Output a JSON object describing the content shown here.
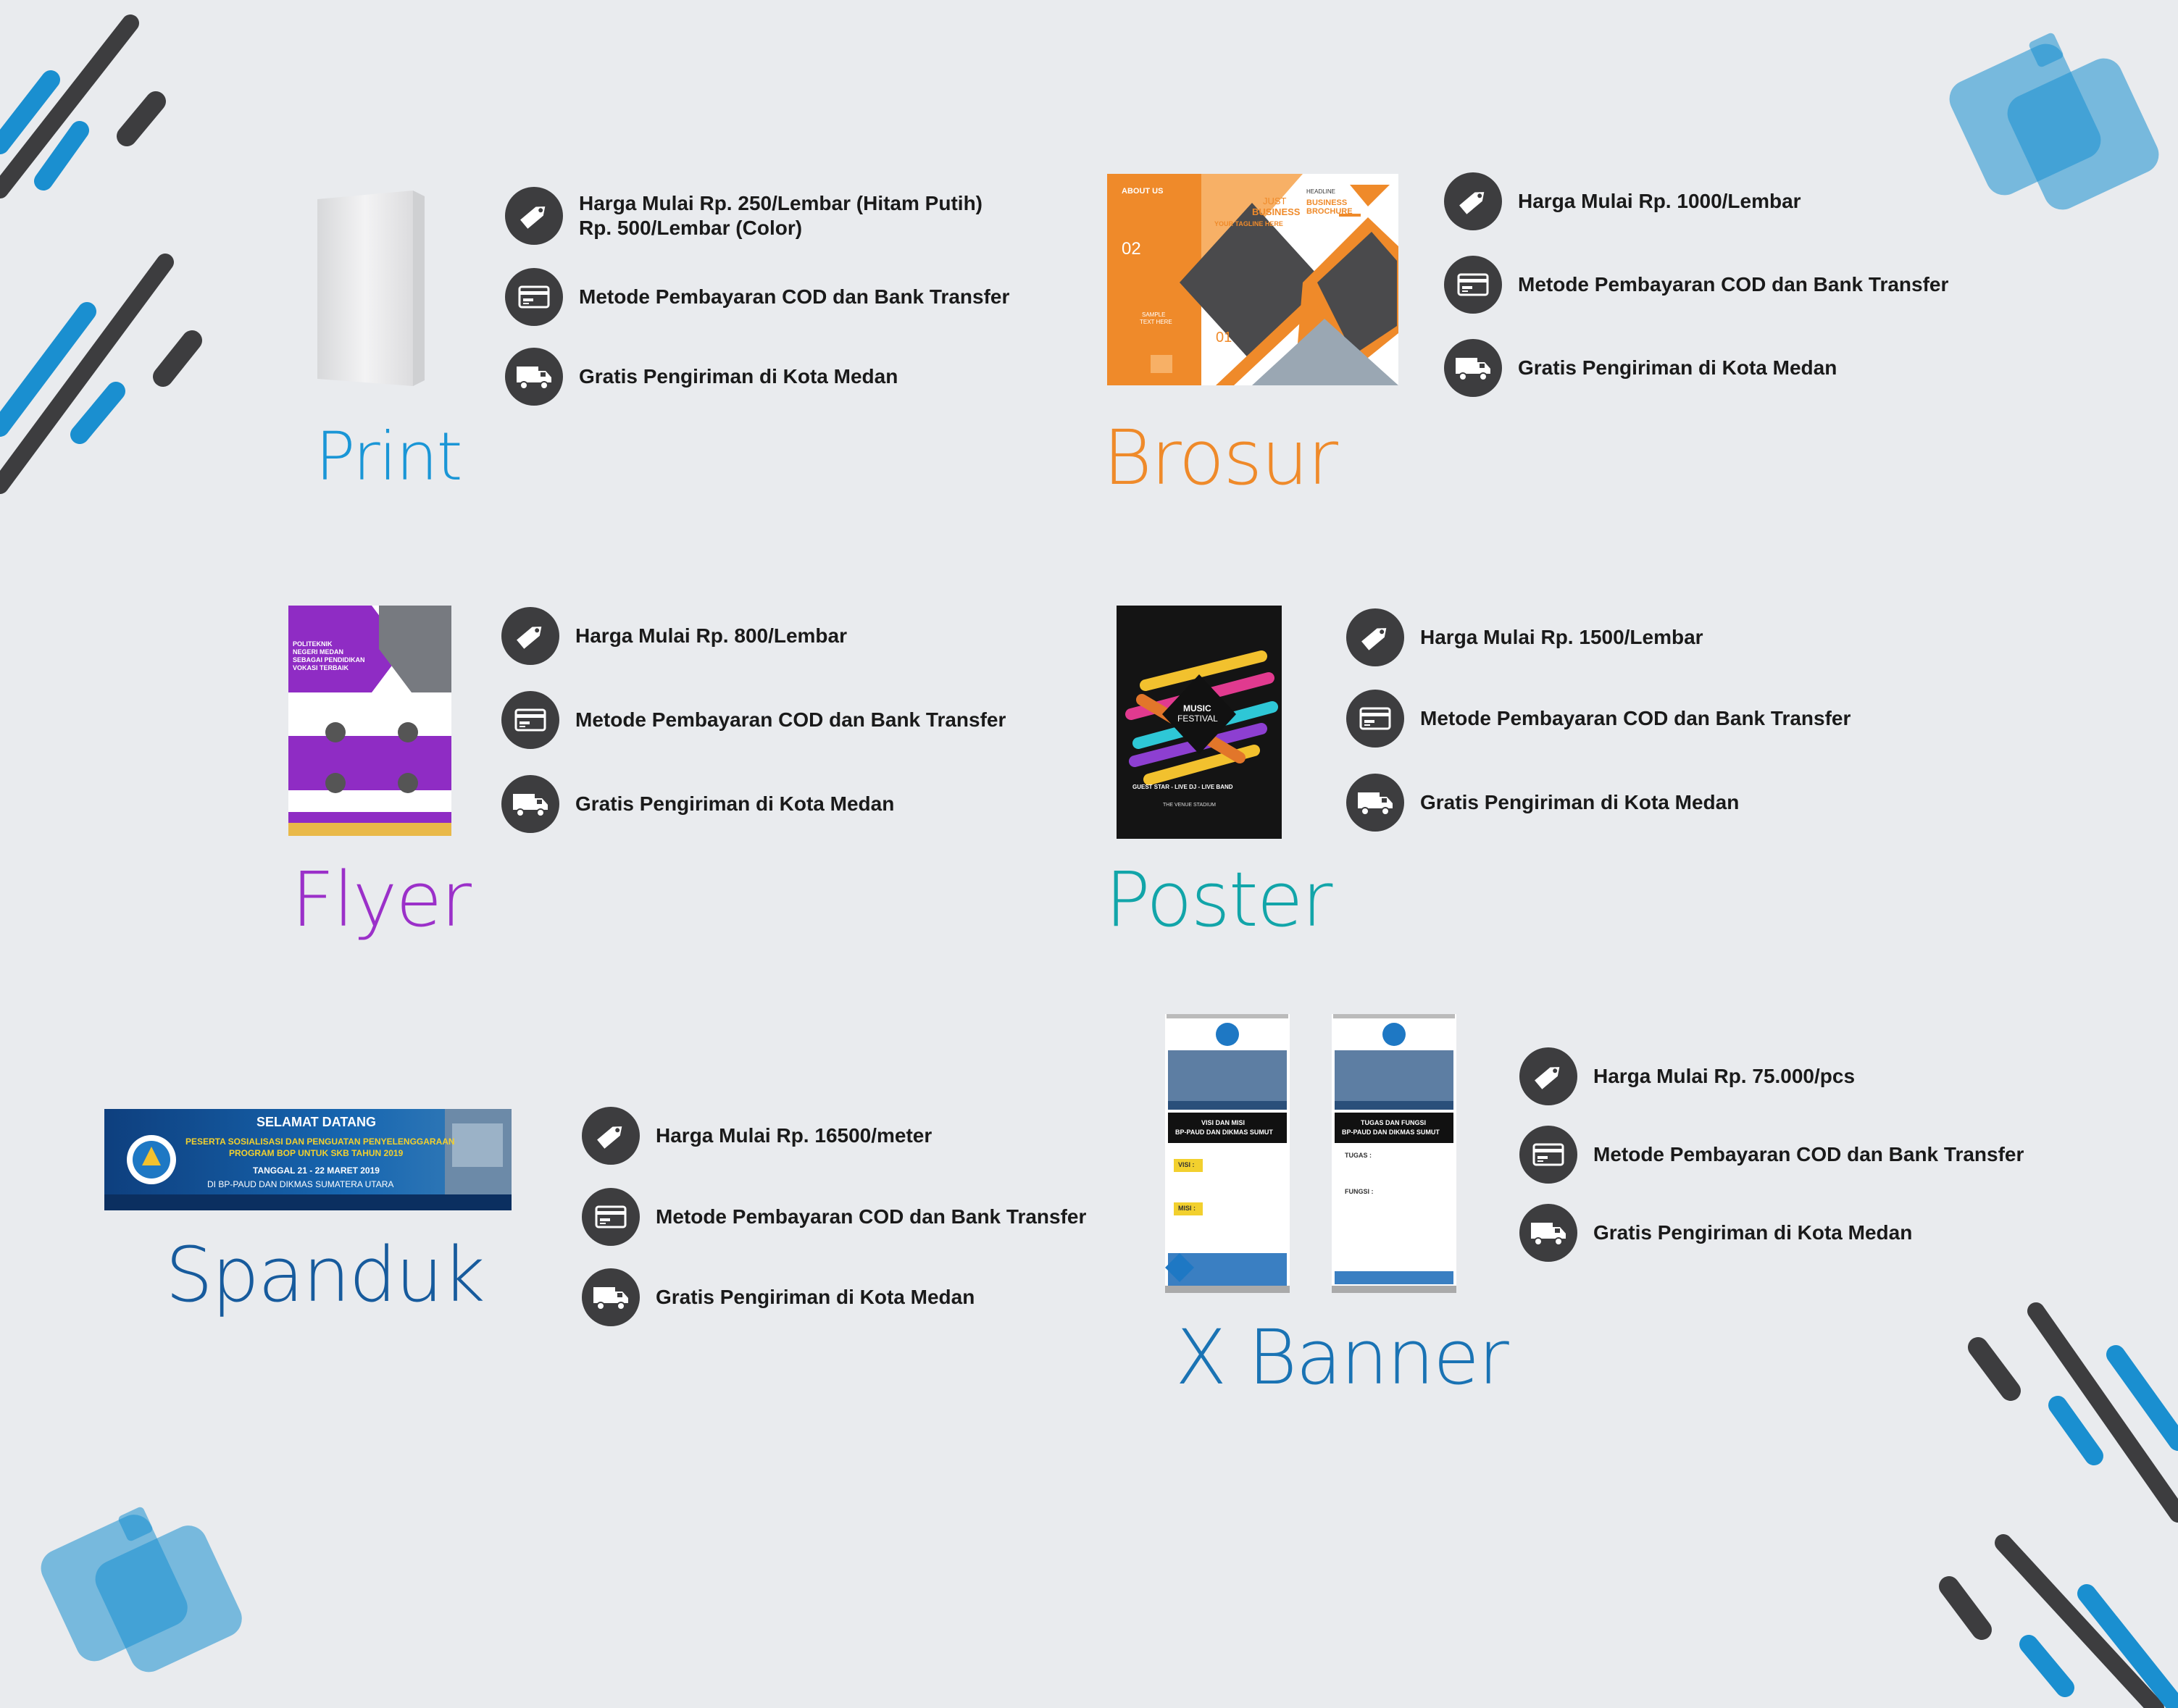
{
  "colors": {
    "background": "#e9ebee",
    "print": "#1a96d6",
    "brosur": "#ef8a2a",
    "flyer": "#9b30c9",
    "poster": "#12a5a9",
    "spanduk": "#175b9d",
    "xbanner": "#1a73b4",
    "icon_bg": "#3d3d3f"
  },
  "icons": [
    "price-tag-icon",
    "payment-card-icon",
    "delivery-truck-icon"
  ],
  "products": {
    "print": {
      "title": "Print",
      "features": [
        {
          "lines": [
            "Harga Mulai Rp. 250/Lembar (Hitam Putih)",
            "Rp. 500/Lembar (Color)"
          ]
        },
        {
          "lines": [
            "Metode Pembayaran COD dan Bank Transfer"
          ]
        },
        {
          "lines": [
            "Gratis Pengiriman di Kota Medan"
          ]
        }
      ]
    },
    "brosur": {
      "title": "Brosur",
      "features": [
        {
          "lines": [
            "Harga Mulai Rp. 1000/Lembar"
          ]
        },
        {
          "lines": [
            "Metode Pembayaran COD dan Bank Transfer"
          ]
        },
        {
          "lines": [
            "Gratis Pengiriman di Kota Medan"
          ]
        }
      ],
      "preview": {
        "about": "ABOUT US",
        "just": "JUST",
        "business": "BUSINESS",
        "tagline": "YOUR TAGLINE HERE",
        "headline": "HEADLINE",
        "brochure_a": "BUSINESS",
        "brochure_b": "BROCHURE",
        "num_a": "02",
        "num_b": "01",
        "sample": "SAMPLE",
        "text_here": "TEXT HERE"
      }
    },
    "flyer": {
      "title": "Flyer",
      "features": [
        {
          "lines": [
            "Harga Mulai Rp. 800/Lembar"
          ]
        },
        {
          "lines": [
            "Metode Pembayaran COD dan Bank Transfer"
          ]
        },
        {
          "lines": [
            "Gratis Pengiriman di Kota Medan"
          ]
        }
      ],
      "preview": {
        "l1": "POLITEKNIK",
        "l2": "NEGERI MEDAN",
        "l3": "SEBAGAI PENDIDIKAN",
        "l4": "VOKASI TERBAIK"
      }
    },
    "poster": {
      "title": "Poster",
      "features": [
        {
          "lines": [
            "Harga Mulai Rp. 1500/Lembar"
          ]
        },
        {
          "lines": [
            "Metode Pembayaran COD dan Bank Transfer"
          ]
        },
        {
          "lines": [
            "Gratis Pengiriman di Kota Medan"
          ]
        }
      ],
      "preview": {
        "music": "MUSIC",
        "festival": "FESTIVAL",
        "guest": "GUEST STAR - LIVE DJ - LIVE BAND",
        "venue": "THE VENUE STADIUM"
      }
    },
    "spanduk": {
      "title": "Spanduk",
      "features": [
        {
          "lines": [
            "Harga Mulai Rp. 16500/meter"
          ]
        },
        {
          "lines": [
            "Metode Pembayaran COD dan Bank Transfer"
          ]
        },
        {
          "lines": [
            "Gratis Pengiriman di Kota Medan"
          ]
        }
      ],
      "preview": {
        "welcome": "SELAMAT DATANG",
        "line1": "PESERTA SOSIALISASI DAN PENGUATAN PENYELENGGARAAN",
        "line2": "PROGRAM BOP UNTUK SKB TAHUN 2019",
        "date": "TANGGAL 21 - 22 MARET 2019",
        "place": "DI BP-PAUD DAN DIKMAS SUMATERA UTARA"
      }
    },
    "xbanner": {
      "title": "X Banner",
      "features": [
        {
          "lines": [
            "Harga Mulai Rp. 75.000/pcs"
          ]
        },
        {
          "lines": [
            "Metode Pembayaran COD dan Bank Transfer"
          ]
        },
        {
          "lines": [
            "Gratis Pengiriman di Kota Medan"
          ]
        }
      ],
      "preview": {
        "left_head_1": "VISI DAN MISI",
        "left_head_2": "BP-PAUD DAN DIKMAS SUMUT",
        "visi": "VISI :",
        "misi": "MISI :",
        "right_head_1": "TUGAS DAN FUNGSI",
        "right_head_2": "BP-PAUD DAN DIKMAS SUMUT",
        "tugas": "TUGAS :",
        "fungsi": "FUNGSI :"
      }
    }
  }
}
